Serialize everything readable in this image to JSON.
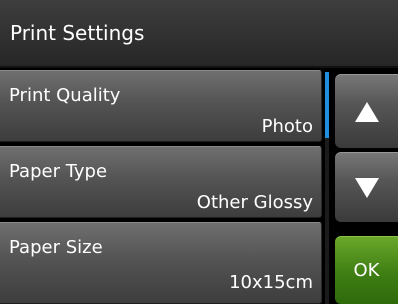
{
  "header": {
    "title": "Print Settings"
  },
  "settings": [
    {
      "label": "Print Quality",
      "value": "Photo"
    },
    {
      "label": "Paper Type",
      "value": "Other Glossy"
    },
    {
      "label": "Paper Size",
      "value": "10x15cm"
    }
  ],
  "scrollbar": {
    "accent_color": "#1e8fe0"
  },
  "buttons": {
    "up_icon": "triangle-up-icon",
    "down_icon": "triangle-down-icon",
    "ok_label": "OK",
    "ok_color": "#3e7e13"
  }
}
